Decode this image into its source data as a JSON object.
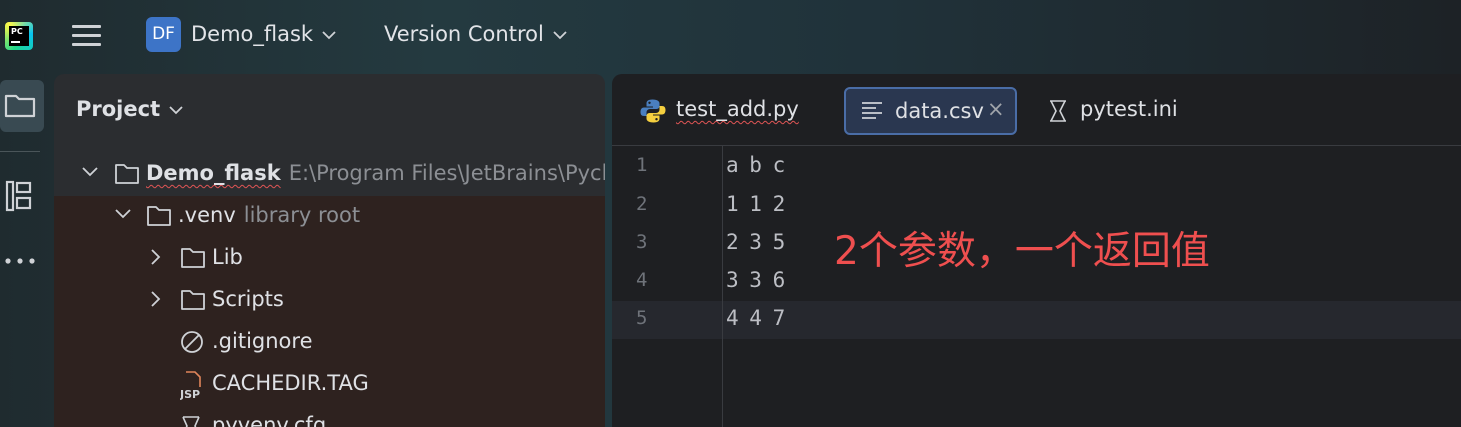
{
  "window": {
    "app_icon": "pycharm-logo",
    "app_icon_text": "PC",
    "project_badge": "DF",
    "project_name": "Demo_flask",
    "version_control_label": "Version Control"
  },
  "toolstrip": {
    "items": [
      {
        "icon": "folder-icon",
        "active": true
      },
      {
        "icon": "structure-icon",
        "active": false
      },
      {
        "icon": "more-icon",
        "active": false
      }
    ]
  },
  "project_panel": {
    "title": "Project",
    "tree": [
      {
        "name": "Demo_flask",
        "hint": "E:\\Program Files\\JetBrains\\Pycha",
        "expanded": true,
        "type": "folder",
        "bold": true
      },
      {
        "name": ".venv",
        "hint": "library root",
        "expanded": true,
        "type": "folder"
      },
      {
        "name": "Lib",
        "hint": "",
        "expanded": false,
        "type": "folder"
      },
      {
        "name": "Scripts",
        "hint": "",
        "expanded": false,
        "type": "folder"
      },
      {
        "name": ".gitignore",
        "hint": "",
        "type": "ignore-file"
      },
      {
        "name": "CACHEDIR.TAG",
        "hint": "",
        "type": "jsp-file",
        "icon_text": "JSP"
      },
      {
        "name": "pyvenv.cfg",
        "hint": "",
        "type": "config-file"
      }
    ]
  },
  "editor": {
    "tabs": [
      {
        "label": "test_add.py",
        "icon": "python-icon",
        "active": false
      },
      {
        "label": "data.csv",
        "icon": "text-file-icon",
        "active": true,
        "close": "×"
      },
      {
        "label": "pytest.ini",
        "icon": "ini-file-icon",
        "active": false
      }
    ],
    "lines": [
      {
        "number": "1",
        "text": "a b c"
      },
      {
        "number": "2",
        "text": "1 1 2"
      },
      {
        "number": "3",
        "text": "2 3 5"
      },
      {
        "number": "4",
        "text": "3 3 6"
      },
      {
        "number": "5",
        "text": "4 4 7"
      }
    ],
    "annotation": "2个参数，一个返回值"
  },
  "colors": {
    "accent": "#3d74c7",
    "annotation": "#ef4f4f",
    "active_tab_border": "#4a6da7"
  }
}
